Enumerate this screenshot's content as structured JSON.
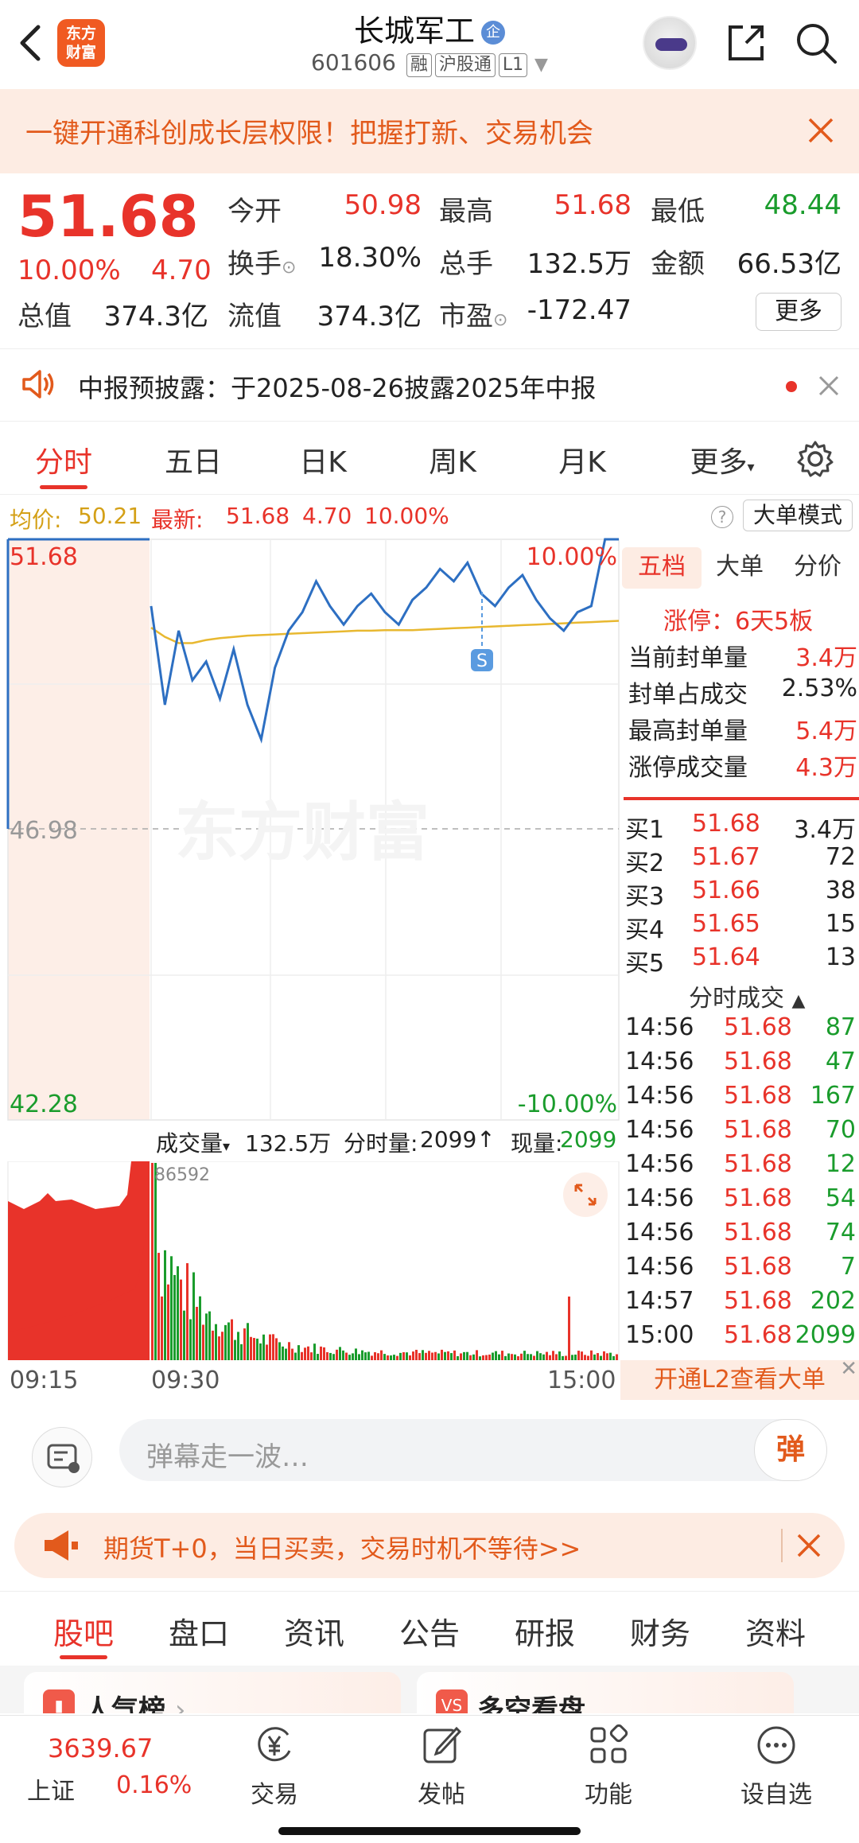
{
  "header": {
    "stock_name": "长城军工",
    "badge": "企",
    "code": "601606",
    "tags": [
      "融",
      "沪股通",
      "L1"
    ],
    "logo_text": "东方财富"
  },
  "banner": {
    "text": "一键开通科创成长层权限！把握打新、交易机会"
  },
  "quote": {
    "price": "51.68",
    "pct": "10.00%",
    "chg": "4.70",
    "open_label": "今开",
    "open": "50.98",
    "high_label": "最高",
    "high": "51.68",
    "low_label": "最低",
    "low": "48.44",
    "turnover_label": "换手",
    "turnover": "18.30%",
    "volume_label": "总手",
    "volume": "132.5万",
    "amount_label": "金额",
    "amount": "66.53亿",
    "mktcap_label": "总值",
    "mktcap": "374.3亿",
    "float_label": "流值",
    "float": "374.3亿",
    "pe_label": "市盈",
    "pe": "-172.47",
    "more": "更多"
  },
  "notice": {
    "text": "中报预披露：于2025-08-26披露2025年中报"
  },
  "chart_tabs": [
    "分时",
    "五日",
    "日K",
    "周K",
    "月K",
    "更多"
  ],
  "summary": {
    "avg_label": "均价:",
    "avg": "50.21",
    "latest_label": "最新:",
    "latest": "51.68",
    "chg": "4.70",
    "pct": "10.00%",
    "bigorder_mode": "大单模式"
  },
  "chart_data": {
    "type": "line",
    "y_top": "51.68",
    "y_mid": "46.98",
    "y_bottom": "42.28",
    "pct_top": "10.00%",
    "pct_bottom": "-10.00%",
    "ylim": [
      42.28,
      51.68
    ],
    "marker": "S",
    "watermark": "东方财富",
    "series": [
      {
        "values": [
          50.6,
          49.0,
          50.2,
          49.4,
          49.7,
          49.1,
          49.9,
          49.0,
          48.44,
          49.6,
          50.2,
          50.5,
          51.0,
          50.6,
          50.3,
          50.6,
          50.8,
          50.5,
          50.3,
          50.7,
          50.9,
          51.2,
          51.0,
          51.3,
          50.8,
          50.6,
          50.9,
          51.1,
          50.7,
          50.4,
          50.2,
          50.5,
          50.6,
          51.68,
          51.68
        ]
      },
      {
        "values": [
          50.25,
          50.1,
          50.0,
          50.0,
          50.05,
          50.08,
          50.1,
          50.12,
          50.13,
          50.14,
          50.15,
          50.16,
          50.17,
          50.18,
          50.19,
          50.2,
          50.2,
          50.21,
          50.21,
          50.21,
          50.22,
          50.23,
          50.24,
          50.25,
          50.26,
          50.27,
          50.28,
          50.29,
          50.3,
          50.31,
          50.32,
          50.33,
          50.34,
          50.35,
          50.36
        ]
      }
    ]
  },
  "orderbook": {
    "tabs": [
      "五档",
      "大单",
      "分价"
    ],
    "limit_up": "涨停：6天5板",
    "stats": [
      {
        "k": "当前封单量",
        "v": "3.4万"
      },
      {
        "k": "封单占成交",
        "v": "2.53%"
      },
      {
        "k": "最高封单量",
        "v": "5.4万"
      },
      {
        "k": "涨停成交量",
        "v": "4.3万"
      }
    ],
    "bids": [
      {
        "l": "买1",
        "p": "51.68",
        "q": "3.4万"
      },
      {
        "l": "买2",
        "p": "51.67",
        "q": "72"
      },
      {
        "l": "买3",
        "p": "51.66",
        "q": "38"
      },
      {
        "l": "买4",
        "p": "51.65",
        "q": "15"
      },
      {
        "l": "买5",
        "p": "51.64",
        "q": "13"
      }
    ],
    "ticks_title": "分时成交",
    "ticks": [
      {
        "t": "14:56",
        "p": "51.68",
        "q": "87"
      },
      {
        "t": "14:56",
        "p": "51.68",
        "q": "47"
      },
      {
        "t": "14:56",
        "p": "51.68",
        "q": "167"
      },
      {
        "t": "14:56",
        "p": "51.68",
        "q": "70"
      },
      {
        "t": "14:56",
        "p": "51.68",
        "q": "12"
      },
      {
        "t": "14:56",
        "p": "51.68",
        "q": "54"
      },
      {
        "t": "14:56",
        "p": "51.68",
        "q": "74"
      },
      {
        "t": "14:56",
        "p": "51.68",
        "q": "7"
      },
      {
        "t": "14:57",
        "p": "51.68",
        "q": "202"
      },
      {
        "t": "15:00",
        "p": "51.68",
        "q": "2099"
      }
    ],
    "l2_link": "开通L2查看大单"
  },
  "volume": {
    "label": "成交量",
    "total": "132.5万",
    "period_label": "分时量:",
    "period": "2099",
    "now_label": "现量:",
    "now": "2099",
    "peak": "86592"
  },
  "time_axis": [
    "09:15",
    "09:30",
    "15:00"
  ],
  "comment": {
    "placeholder": "弹幕走一波…",
    "danmu": "弹"
  },
  "promo": {
    "text": "期货T+0，当日买卖，交易时机不等待>>"
  },
  "info_tabs": [
    "股吧",
    "盘口",
    "资讯",
    "公告",
    "研报",
    "财务",
    "资料"
  ],
  "cards": [
    "人气榜",
    "多空看盘"
  ],
  "bottom_nav": {
    "index_value": "3639.67",
    "index_name": "上证",
    "index_pct": "0.16%",
    "items": [
      "交易",
      "发帖",
      "功能",
      "设自选"
    ]
  }
}
